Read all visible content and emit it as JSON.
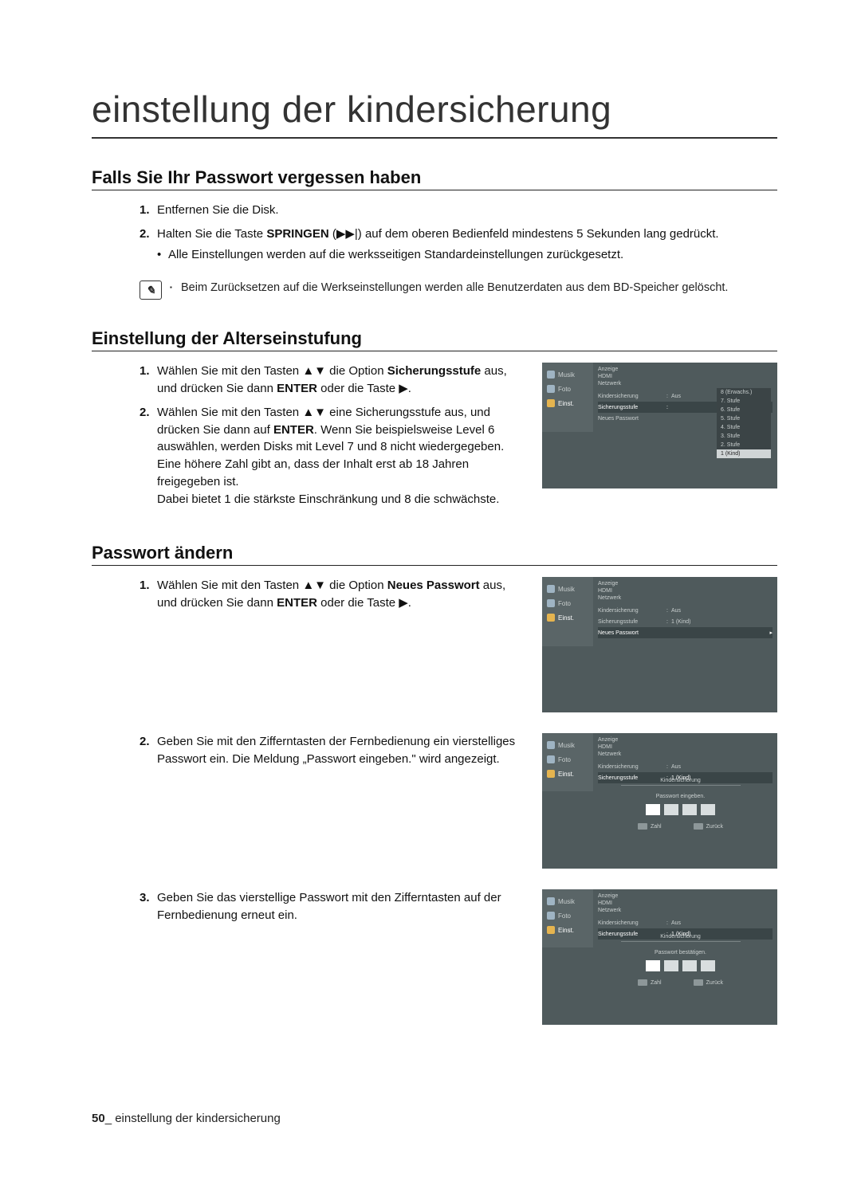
{
  "main_title": "einstellung der kindersicherung",
  "s1": {
    "heading": "Falls Sie Ihr Passwort vergessen haben",
    "step1_num": "1.",
    "step1": "Entfernen Sie die Disk.",
    "step2_num": "2.",
    "step2_a": "Halten Sie die Taste ",
    "step2_bold": "SPRINGEN",
    "step2_b": " (▶▶|) auf dem oberen Bedienfeld mindestens 5 Sekunden lang gedrückt.",
    "step2_bullet": "Alle Einstellungen werden auf die werksseitigen Standardeinstellungen zurückgesetzt.",
    "note": "Beim Zurücksetzen auf die Werkseinstellungen werden alle Benutzerdaten aus dem BD-Speicher gelöscht."
  },
  "s2": {
    "heading": "Einstellung der Alterseinstufung",
    "step1_num": "1.",
    "step1_a": "Wählen Sie mit den Tasten ▲▼ die Option ",
    "step1_bold": "Sicherungsstufe",
    "step1_b": " aus, und drücken Sie dann ",
    "step1_bold2": "ENTER",
    "step1_c": " oder die Taste ▶.",
    "step2_num": "2.",
    "step2_a": "Wählen Sie mit den Tasten ▲▼ eine Sicherungsstufe aus, und drücken Sie dann auf ",
    "step2_bold": "ENTER",
    "step2_b": ". Wenn Sie beispielsweise Level 6 auswählen, werden Disks mit Level 7 und 8 nicht wiedergegeben.",
    "step2_c": "Eine höhere Zahl gibt an, dass der Inhalt erst ab 18 Jahren freigegeben ist.",
    "step2_d": "Dabei bietet 1 die stärkste Einschränkung und 8 die schwächste."
  },
  "s3": {
    "heading": "Passwort ändern",
    "step1_num": "1.",
    "step1_a": "Wählen Sie mit den Tasten ▲▼ die Option ",
    "step1_bold": "Neues Passwort",
    "step1_b": " aus, und drücken Sie dann ",
    "step1_bold2": "ENTER",
    "step1_c": " oder die Taste ▶.",
    "step2_num": "2.",
    "step2": "Geben Sie mit den Zifferntasten der Fernbedienung ein vierstelliges Passwort ein. Die Meldung „Passwort eingeben.\" wird angezeigt.",
    "step3_num": "3.",
    "step3": "Geben Sie das vierstellige Passwort mit den Zifferntasten auf der Fernbedienung erneut ein."
  },
  "screenshot": {
    "sidebar": {
      "music": "Musik",
      "foto": "Foto",
      "einst": "Einst."
    },
    "headers": {
      "anzeige": "Anzeige",
      "hdmi": "HDMI",
      "netzwerk": "Netzwerk",
      "kinders": "Kindersicherung"
    },
    "rows": {
      "kinders": "Kindersicherung",
      "kinders_val": "Aus",
      "stufe": "Sicherungsstufe",
      "stufe_val": "1 (Kind)",
      "neupw": "Neues Passwort"
    },
    "dropdown": [
      "8 (Erwachs.)",
      "7. Stufe",
      "6. Stufe",
      "5. Stufe",
      "4. Stufe",
      "3. Stufe",
      "2. Stufe",
      "1 (Kind)"
    ],
    "dropdown_sel_index": 7,
    "overlay_title": "Kindersicherung",
    "pw_enter": "Passwort eingeben.",
    "pw_confirm": "Passwort bestätigen.",
    "hint_num": "Zahl",
    "hint_back": "Zurück"
  },
  "footer": {
    "page": "50",
    "sep": "_ ",
    "text": "einstellung der kindersicherung"
  }
}
